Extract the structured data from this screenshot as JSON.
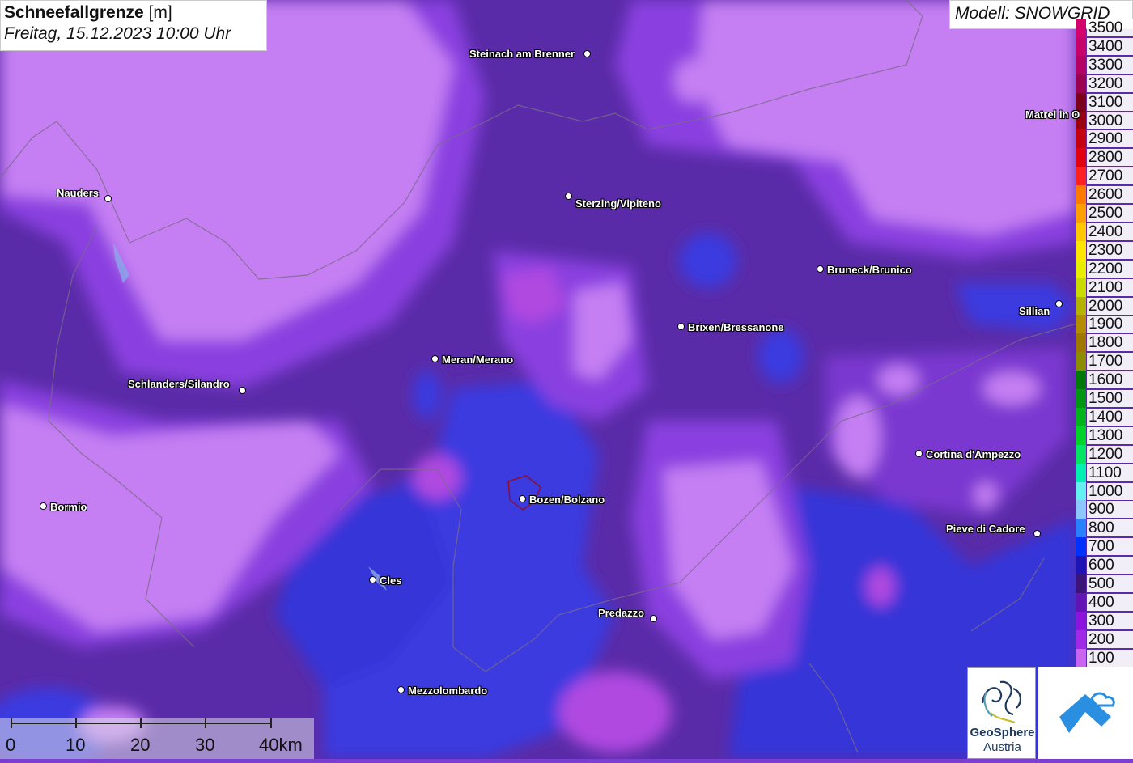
{
  "title": {
    "main": "Schneefallgrenze",
    "unit": "[m]",
    "datetime": "Freitag, 15.12.2023 10:00 Uhr"
  },
  "model": "Modell: SNOWGRID",
  "legend": [
    {
      "label": "3500",
      "color": "#d4006e"
    },
    {
      "label": "3400",
      "color": "#c8006a"
    },
    {
      "label": "3300",
      "color": "#b40064"
    },
    {
      "label": "3200",
      "color": "#9b0050"
    },
    {
      "label": "3100",
      "color": "#7a001c"
    },
    {
      "label": "3000",
      "color": "#9b0010"
    },
    {
      "label": "2900",
      "color": "#c40010"
    },
    {
      "label": "2800",
      "color": "#e00010"
    },
    {
      "label": "2700",
      "color": "#ff2020"
    },
    {
      "label": "2600",
      "color": "#ff7a00"
    },
    {
      "label": "2500",
      "color": "#ffa000"
    },
    {
      "label": "2400",
      "color": "#ffc800"
    },
    {
      "label": "2300",
      "color": "#ffe600"
    },
    {
      "label": "2200",
      "color": "#e8f000"
    },
    {
      "label": "2100",
      "color": "#c8dc00"
    },
    {
      "label": "2000",
      "color": "#b4b400"
    },
    {
      "label": "1900",
      "color": "#b48c00"
    },
    {
      "label": "1800",
      "color": "#a07800"
    },
    {
      "label": "1700",
      "color": "#8c8c00"
    },
    {
      "label": "1600",
      "color": "#00780a"
    },
    {
      "label": "1500",
      "color": "#009614"
    },
    {
      "label": "1400",
      "color": "#00b41e"
    },
    {
      "label": "1300",
      "color": "#00d228"
    },
    {
      "label": "1200",
      "color": "#00e664"
    },
    {
      "label": "1100",
      "color": "#00f0b4"
    },
    {
      "label": "1000",
      "color": "#64f0f0"
    },
    {
      "label": "900",
      "color": "#8cc8ff"
    },
    {
      "label": "800",
      "color": "#2882ff"
    },
    {
      "label": "700",
      "color": "#0032ff"
    },
    {
      "label": "600",
      "color": "#1e14b4"
    },
    {
      "label": "500",
      "color": "#3c1478"
    },
    {
      "label": "400",
      "color": "#6414b4"
    },
    {
      "label": "300",
      "color": "#8c14dc"
    },
    {
      "label": "200",
      "color": "#a028e6"
    },
    {
      "label": "100",
      "color": "#c864f0"
    }
  ],
  "cities": [
    {
      "name": "Steinach am Brenner"
    },
    {
      "name": "Nauders"
    },
    {
      "name": "Sterzing/Vipiteno"
    },
    {
      "name": "Bruneck/Brunico"
    },
    {
      "name": "Sillian"
    },
    {
      "name": "Matrei in O"
    },
    {
      "name": "Brixen/Bressanone"
    },
    {
      "name": "Meran/Merano"
    },
    {
      "name": "Schlanders/Silandro"
    },
    {
      "name": "Cortina d'Ampezzo"
    },
    {
      "name": "Bormio"
    },
    {
      "name": "Bozen/Bolzano"
    },
    {
      "name": "Pieve di Cadore"
    },
    {
      "name": "Cles"
    },
    {
      "name": "Predazzo"
    },
    {
      "name": "Mezzolombardo"
    }
  ],
  "scale": {
    "labels": [
      "0",
      "10",
      "20",
      "30",
      "40km"
    ]
  },
  "logo": {
    "line1": "GeoSphere",
    "line2": "Austria"
  }
}
